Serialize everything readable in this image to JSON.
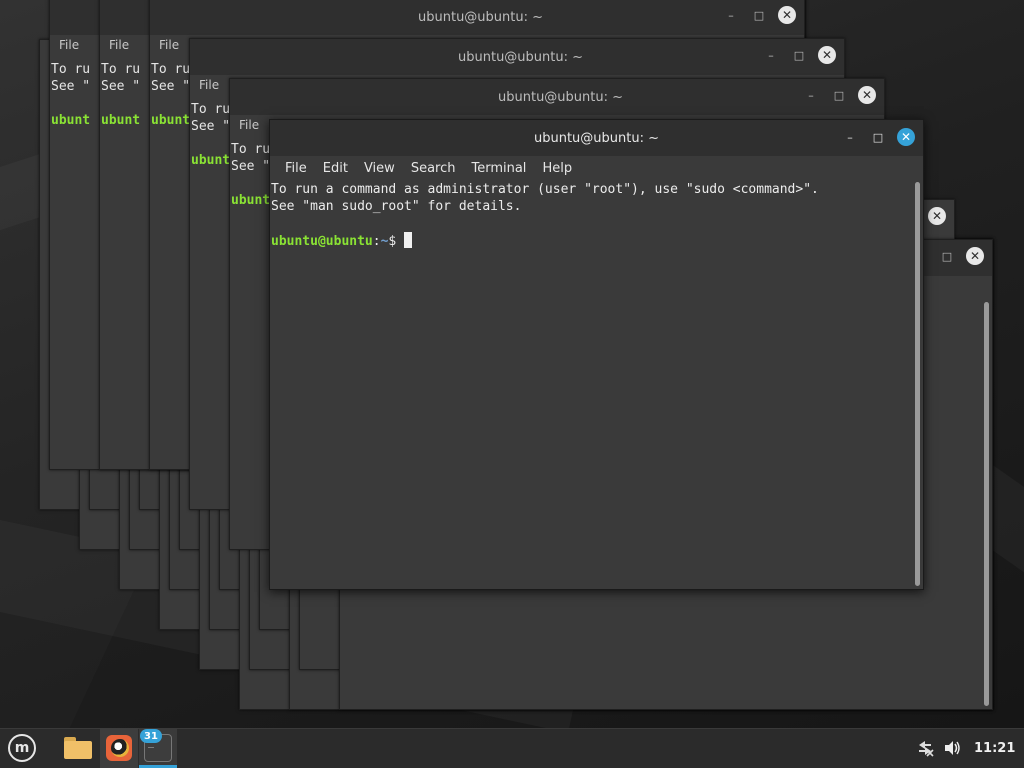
{
  "windows": {
    "title": "ubuntu@ubuntu: ~",
    "menu": {
      "file": "File",
      "edit": "Edit",
      "view": "View",
      "search": "Search",
      "terminal": "Terminal",
      "help": "Help"
    },
    "ghost_fragments": {
      "line1": "To ru",
      "line2": "See \"",
      "short1": "T",
      "short2": "S",
      "prompt_frag": "ubunt",
      "prompt_frag_long": "ubuntu"
    }
  },
  "terminal": {
    "line1": "To run a command as administrator (user \"root\"), use \"sudo <command>\".",
    "line2": "See \"man sudo_root\" for details.",
    "prompt_user": "ubuntu@ubuntu",
    "prompt_sep": ":",
    "prompt_path": "~",
    "prompt_symbol": "$"
  },
  "taskbar": {
    "terminal_badge": "31",
    "clock": "11:21"
  },
  "icons": {
    "menu": "mint-logo-icon",
    "files": "folder-icon",
    "browser": "firefox-icon",
    "terminal": "terminal-icon",
    "network": "network-disconnected-icon",
    "volume": "volume-icon"
  },
  "colors": {
    "accent": "#35a2d8",
    "prompt_green": "#8ae234",
    "prompt_blue": "#729fcf"
  }
}
